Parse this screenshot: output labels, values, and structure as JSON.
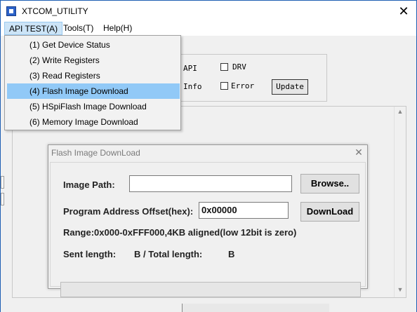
{
  "window": {
    "title": "XTCOM_UTILITY",
    "close_glyph": "✕"
  },
  "menubar": {
    "items": [
      "API TEST(A)",
      "Tools(T)",
      "Help(H)"
    ]
  },
  "dropdown": {
    "items": [
      "(1) Get Device Status",
      "(2) Write Registers",
      "(3) Read Registers",
      "(4) Flash Image Download",
      "(5) HSpiFlash Image Download",
      "(6) Memory Image Download"
    ],
    "selected_index": 3
  },
  "options": {
    "api": "API",
    "drv": "DRV",
    "info": "Info",
    "error": "Error",
    "update": "Update"
  },
  "dialog": {
    "title": "Flash Image DownLoad",
    "close_glyph": "✕",
    "image_path_label": "Image Path:",
    "image_path_value": "",
    "browse_label": "Browse..",
    "offset_label": "Program Address Offset(hex):",
    "offset_value": "0x00000",
    "download_label": "DownLoad",
    "range_text": "Range:0x000-0xFFF000,4KB aligned(low 12bit is zero)",
    "sent_label": "Sent length:",
    "b_total": "B / Total length:",
    "b_end": "B",
    "progress": 0
  },
  "colors": {
    "menu_highlight": "#cce4f7",
    "item_selected": "#91c9f7",
    "window_border": "#1e5fb3"
  }
}
